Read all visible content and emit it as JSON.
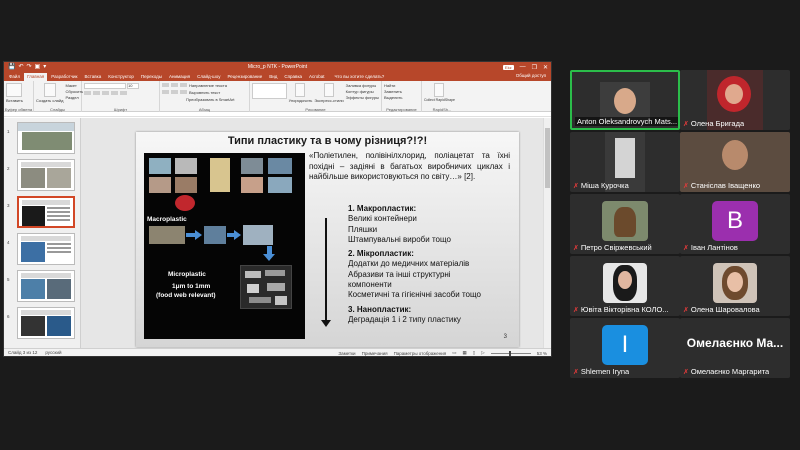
{
  "ppt": {
    "window_title": "Micro_p NTK - PowerPoint",
    "qat": [
      "💾",
      "↶",
      "↷",
      "▣",
      "▾"
    ],
    "account_badge": "Ekz",
    "window_controls": [
      "—",
      "❐",
      "✕"
    ],
    "tabs": [
      "Файл",
      "Главная",
      "Разработчик",
      "Вставка",
      "Конструктор",
      "Переходы",
      "Анимация",
      "Слайд-шоу",
      "Рецензирование",
      "Вид",
      "Справка",
      "Acrobat"
    ],
    "active_tab_index": 1,
    "search_tab": "Что вы хотите сделать?",
    "share_label": "Общий доступ",
    "ribbon": {
      "paste": "Вставить",
      "clipboard_group": "Буфер обмена",
      "new_slide": "Создать слайд",
      "layout": "Макет",
      "reset": "Сбросить",
      "section": "Раздел",
      "slides_group": "Слайды",
      "font_group": "Шрифт",
      "font_size": "10",
      "paragraph_group": "Абзац",
      "text_direction": "Направление текста",
      "align_text": "Выровнять текст",
      "smartart": "Преобразовать в SmartArt",
      "arrange": "Упорядочить",
      "express_styles": "Экспресс-стили",
      "drawing_group": "Рисование",
      "shape_fill": "Заливка фигуры",
      "shape_outline": "Контур фигуры",
      "shape_effects": "Эффекты фигуры",
      "find": "Найти",
      "replace": "Заменить",
      "select": "Выделить",
      "editing_group": "Редактирование",
      "collect_label": "Collect RapidShape",
      "addins_group": "RapidSh..."
    },
    "thumbnails": [
      "1",
      "2",
      "3",
      "4",
      "5",
      "6"
    ],
    "selected_thumb_index": 2,
    "status": {
      "slide_info": "Слайд 3 из 12",
      "language": "русский",
      "notes": "Заметки",
      "comments": "Примечания",
      "view_mode": "Параметры отображения",
      "zoom": "53 %"
    }
  },
  "slide": {
    "title": "Типи пластику та в чому різниця?!?!",
    "quote": "«Поліетилен, полівінілхлорид, поліацетат та їхні похідні – задіяні в багатьох виробничих циклах і найбільше використовуються по світу…» [2].",
    "img_label_macro": "Macroplastic",
    "img_label_micro": "Microplastic",
    "img_label_micro_size": "1μm to 1mm",
    "img_label_micro_note": "(food web relevant)",
    "b1_head": "1. Макропластик:",
    "b1_l1": "Великі контейнери",
    "b1_l2": "Пляшки",
    "b1_l3": "Штампувальні вироби тощо",
    "b2_head": "2. Мікропластик:",
    "b2_l1": "Додатки до медичних матеріалів",
    "b2_l2": "Абразиви та інші структурні",
    "b2_l3": "компоненти",
    "b2_l4": "Косметичні та гігієнічні засоби тощо",
    "b3_head": "3. Нанопластик:",
    "b3_l1": "Деградація 1 і 2 типу пластику",
    "number": "3"
  },
  "gallery": {
    "participants": [
      {
        "name": "Anton Oleksandrovych Mats...",
        "muted": false,
        "active": true
      },
      {
        "name": "Олена Бригада",
        "muted": true
      },
      {
        "name": "Міша Курочка",
        "muted": true
      },
      {
        "name": "Станіслав Іващенко",
        "muted": true
      },
      {
        "name": "Петро Свіржевський",
        "muted": true
      },
      {
        "name": "Іван Лантінов",
        "muted": true,
        "letter": "B",
        "color": "#9b2fae"
      },
      {
        "name": "Ювіта Вікторівна КОЛО...",
        "muted": true
      },
      {
        "name": "Олена Шаровалова",
        "muted": true
      },
      {
        "name": "Shlemen Iryna",
        "muted": true,
        "letter": "I",
        "color": "#1a8fe0"
      },
      {
        "name": "Омелаєнко Маргарита",
        "muted": true,
        "big_name": "Омелаєнко Ма..."
      }
    ],
    "mic_icon": "🎙"
  }
}
